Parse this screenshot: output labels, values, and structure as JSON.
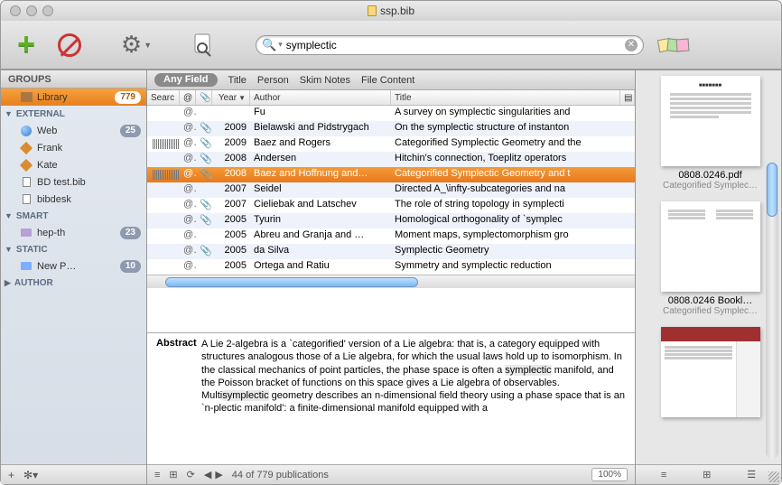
{
  "window": {
    "title": "ssp.bib"
  },
  "toolbar": {
    "search_value": "symplectic"
  },
  "sidebar": {
    "header": "GROUPS",
    "library": {
      "label": "Library",
      "count": "779"
    },
    "sections": [
      {
        "label": "EXTERNAL",
        "expanded": true,
        "items": [
          {
            "icon": "globe",
            "label": "Web",
            "count": "25"
          },
          {
            "icon": "diamond",
            "label": "Frank"
          },
          {
            "icon": "diamond",
            "label": "Kate"
          },
          {
            "icon": "doc",
            "label": "BD test.bib"
          },
          {
            "icon": "doc",
            "label": "bibdesk"
          }
        ]
      },
      {
        "label": "SMART",
        "expanded": true,
        "items": [
          {
            "icon": "gearfolder",
            "label": "hep-th",
            "count": "23"
          }
        ]
      },
      {
        "label": "STATIC",
        "expanded": true,
        "items": [
          {
            "icon": "folder",
            "label": "New P…",
            "count": "10"
          }
        ]
      },
      {
        "label": "AUTHOR",
        "expanded": false,
        "items": []
      }
    ]
  },
  "scope": {
    "selected": "Any Field",
    "options": [
      "Title",
      "Person",
      "Skim Notes",
      "File Content"
    ]
  },
  "table": {
    "columns": {
      "search": "Searc",
      "year": "Year",
      "author": "Author",
      "title": "Title"
    },
    "rows": [
      {
        "at": true,
        "clip": false,
        "year": "",
        "author": "Fu",
        "title": "A survey on symplectic singularities and",
        "bar": false
      },
      {
        "at": true,
        "clip": true,
        "year": "2009",
        "author": "Bielawski and Pidstrygach",
        "title": "On the symplectic structure of instanton",
        "bar": false
      },
      {
        "at": true,
        "clip": true,
        "year": "2009",
        "author": "Baez and Rogers",
        "title": "Categorified Symplectic Geometry and the",
        "bar": true
      },
      {
        "at": true,
        "clip": true,
        "year": "2008",
        "author": "Andersen",
        "title": "Hitchin's connection, Toeplitz operators",
        "bar": false
      },
      {
        "at": true,
        "clip": true,
        "year": "2008",
        "author": "Baez and Hoffnung and…",
        "title": "Categorified Symplectic Geometry and t",
        "bar": true,
        "selected": true
      },
      {
        "at": true,
        "clip": false,
        "year": "2007",
        "author": "Seidel",
        "title": "Directed A_\\infty-subcategories and na",
        "bar": false
      },
      {
        "at": true,
        "clip": true,
        "year": "2007",
        "author": "Cieliebak and Latschev",
        "title": "The role of string topology in symplecti",
        "bar": false
      },
      {
        "at": true,
        "clip": true,
        "year": "2005",
        "author": "Tyurin",
        "title": "Homological orthogonality of `symplec",
        "bar": false
      },
      {
        "at": true,
        "clip": false,
        "year": "2005",
        "author": "Abreu and Granja and …",
        "title": "Moment maps, symplectomorphism gro",
        "bar": false
      },
      {
        "at": true,
        "clip": true,
        "year": "2005",
        "author": "da Silva",
        "title": "Symplectic Geometry",
        "bar": false
      },
      {
        "at": true,
        "clip": false,
        "year": "2005",
        "author": "Ortega and Ratiu",
        "title": "Symmetry and symplectic reduction",
        "bar": false
      }
    ]
  },
  "abstract": {
    "heading": "Abstract",
    "text_before_hl1": "A Lie 2-algebra is a `categorified' version of a Lie algebra: that is, a category equipped with structures analogous those of a Lie algebra, for which the usual laws hold up to isomorphism. In the classical mechanics of point particles, the phase space is often a ",
    "hl1": "symplectic",
    "text_mid": " manifold, and the Poisson bracket of functions on this space gives a Lie algebra of observables. Multi",
    "hl2": "symplectic",
    "text_after_hl2": " geometry describes an n-dimensional field theory using a phase space that is an `n-plectic manifold': a finite-dimensional manifold equipped with a"
  },
  "footer": {
    "counter": "44 of 779 publications",
    "zoom": "100%"
  },
  "rightpane": {
    "items": [
      {
        "type": "pdf",
        "title": "0808.0246.pdf",
        "subtitle": "Categorified Symplec…"
      },
      {
        "type": "double",
        "title": "0808.0246 Bookl…",
        "subtitle": "Categorified Symplec…"
      },
      {
        "type": "web",
        "title": "",
        "subtitle": ""
      }
    ]
  }
}
